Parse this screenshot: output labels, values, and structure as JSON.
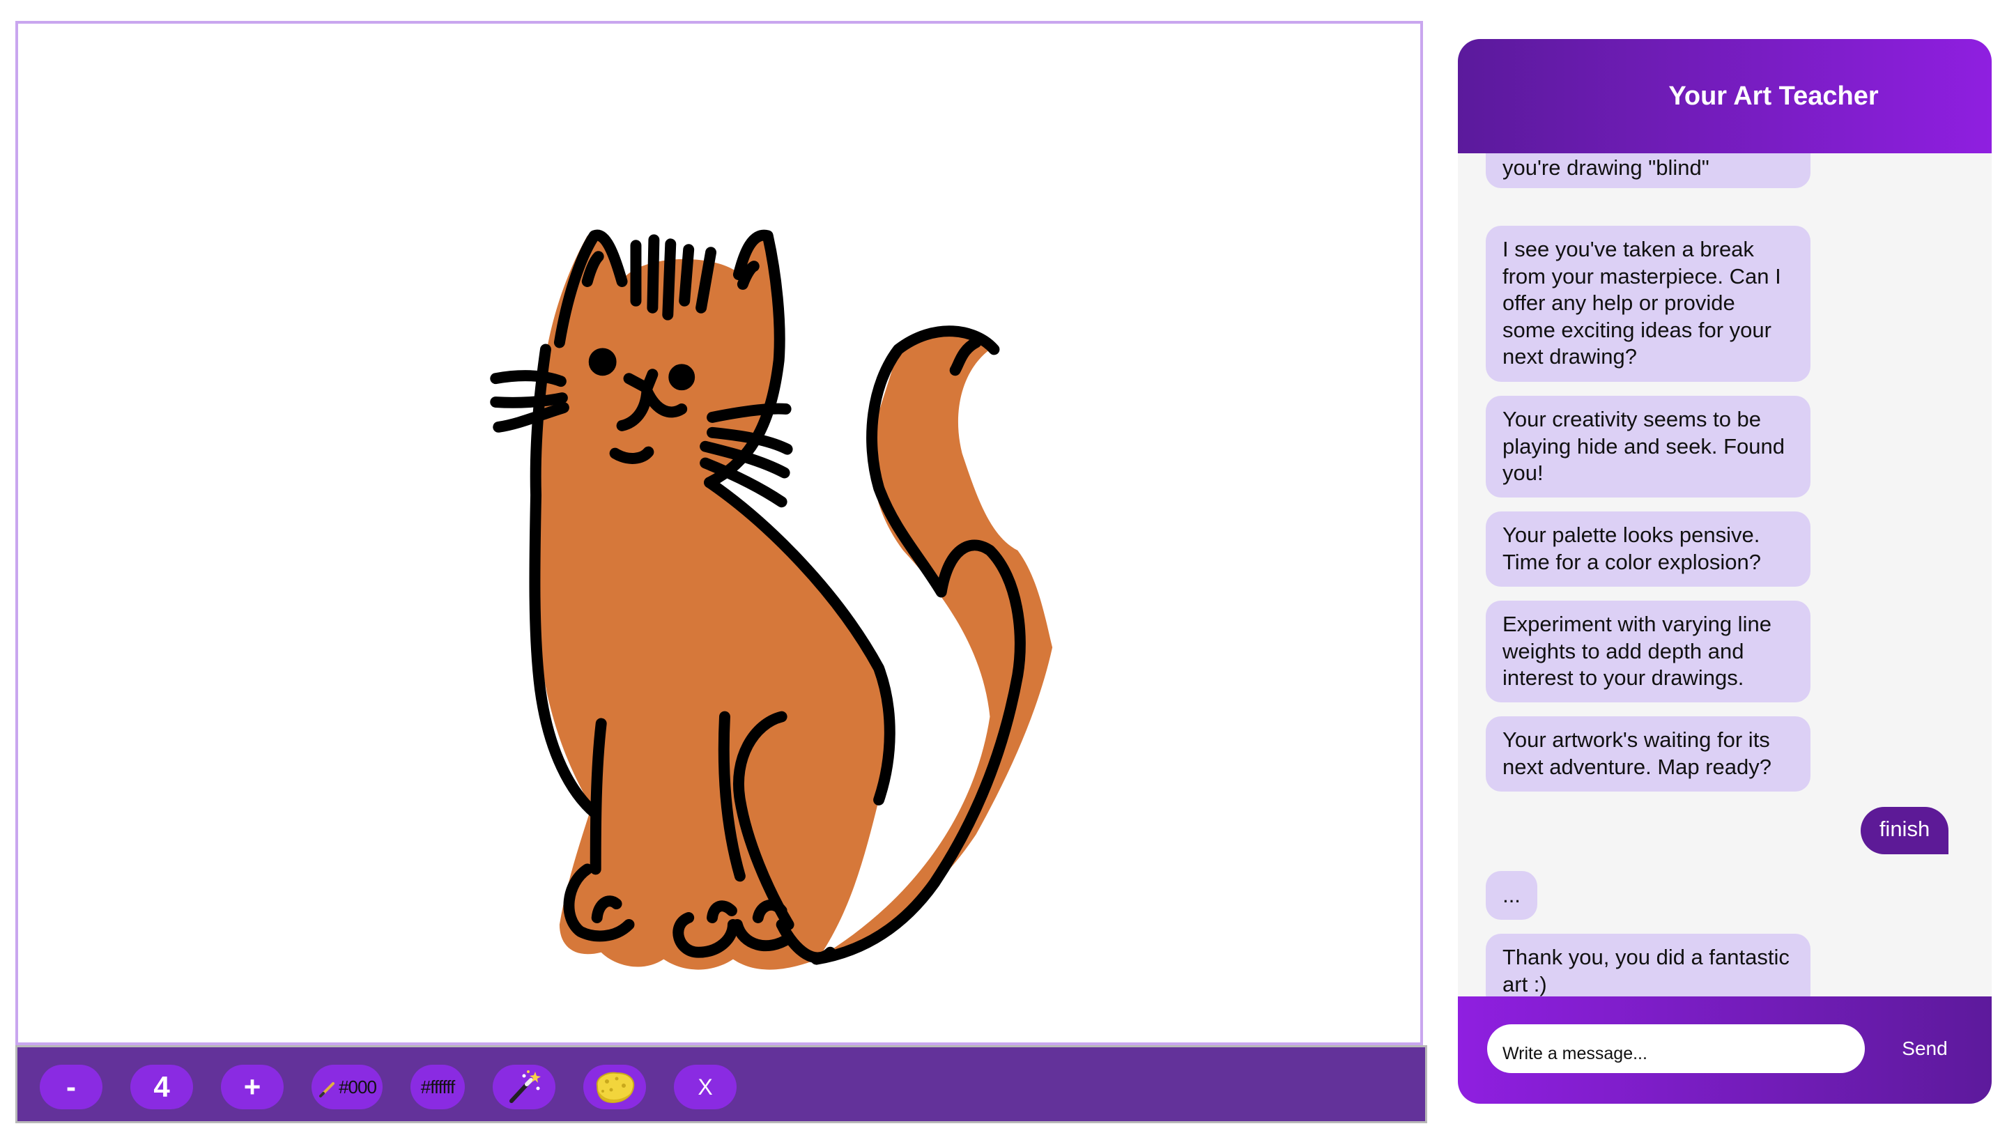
{
  "toolbar": {
    "decrease_label": "-",
    "brush_size": "4",
    "increase_label": "+",
    "stroke_color_label": "#000",
    "fill_color_label": "#ffffff",
    "magic_icon": "magic-wand-icon",
    "eraser_icon": "sponge-icon",
    "clear_label": "X"
  },
  "chat": {
    "title": "Your Art Teacher",
    "messages": [
      {
        "role": "bot",
        "text": "you're drawing \"blind\""
      },
      {
        "role": "bot",
        "text": "I see you've taken a break from your masterpiece. Can I offer any help or provide some exciting ideas for your next drawing?"
      },
      {
        "role": "bot",
        "text": "Your creativity seems to be playing hide and seek. Found you!"
      },
      {
        "role": "bot",
        "text": "Your palette looks pensive. Time for a color explosion?"
      },
      {
        "role": "bot",
        "text": "Experiment with varying line weights to add depth and interest to your drawings."
      },
      {
        "role": "bot",
        "text": "Your artwork's waiting for its next adventure. Map ready?"
      },
      {
        "role": "user",
        "text": "finish"
      },
      {
        "role": "bot",
        "text": "..."
      },
      {
        "role": "bot",
        "text": "Thank you, you did a fantastic art :)"
      }
    ],
    "input_placeholder": "Write a message...",
    "send_label": "Send"
  },
  "colors": {
    "accent": "#8a2be2",
    "toolbar_bg": "#63329a",
    "canvas_border": "#c9a6ef",
    "bot_bubble": "#dcd0f5",
    "user_bubble": "#5d1a97",
    "cat_fill": "#d6783a"
  }
}
